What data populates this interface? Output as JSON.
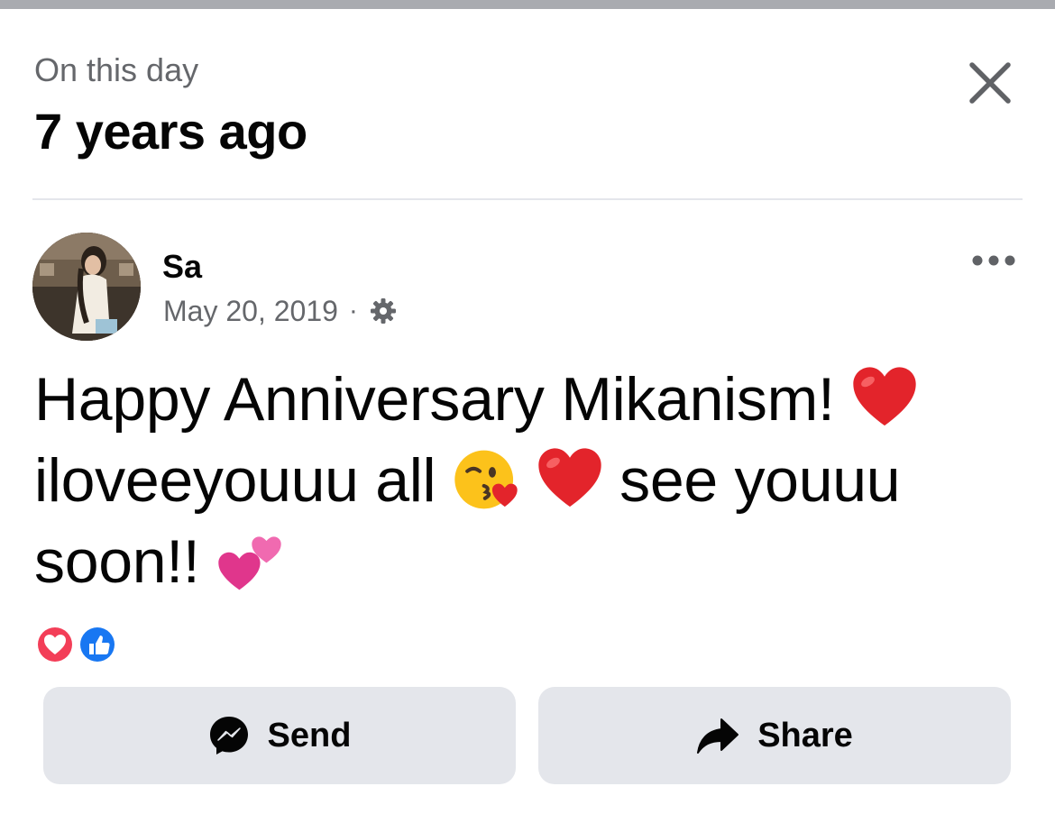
{
  "header": {
    "eyebrow": "On this day",
    "title": "7 years ago",
    "close_icon": "close-icon"
  },
  "post": {
    "author": "Sa",
    "date": "May 20, 2019",
    "separator": "·",
    "privacy_icon": "gear-icon",
    "more_icon": "more-dots-icon",
    "text_line1": "Happy Anniversary Mikanism!",
    "text_line2": "iloveeyouuu all",
    "text_line2b": "see youuu",
    "text_line3": "soon!!",
    "emojis": [
      "red-heart",
      "face-blowing-kiss",
      "red-heart",
      "two-hearts"
    ],
    "reactions": [
      "love-reaction",
      "like-reaction"
    ]
  },
  "actions": {
    "send_label": "Send",
    "share_label": "Share"
  },
  "colors": {
    "secondary_text": "#65676b",
    "button_bg": "#e4e6eb",
    "love_red": "#f33e58",
    "like_blue": "#1877f2"
  }
}
